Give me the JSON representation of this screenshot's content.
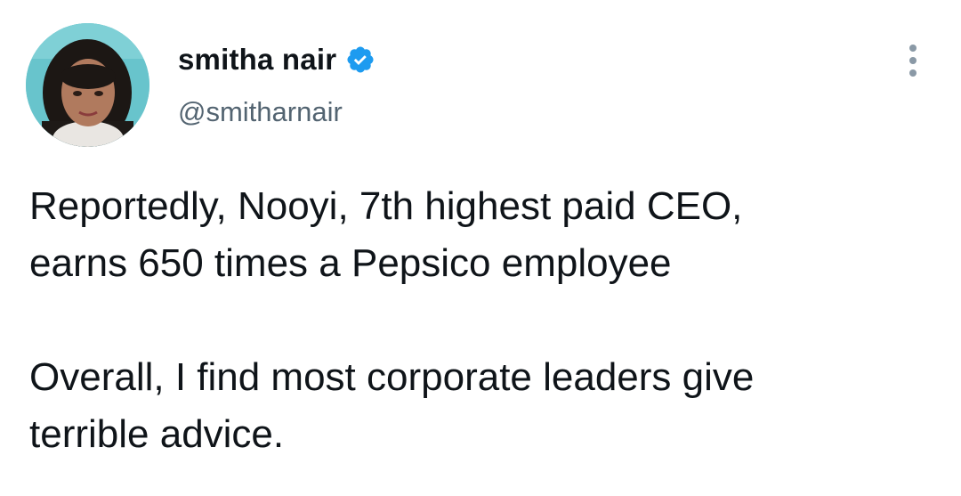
{
  "tweet": {
    "author": {
      "display_name": "smitha nair",
      "handle": "@smitharnair",
      "verified_icon": "verified-badge-icon",
      "avatar_icon": "profile-photo"
    },
    "more_icon": "more-options-icon",
    "body": {
      "line1": "Reportedly, Nooyi, 7th highest paid CEO,",
      "line2": "earns 650 times a Pepsico employee",
      "line3": "Overall, I find most corporate leaders give",
      "line4": "terrible advice."
    },
    "colors": {
      "text": "#0f1419",
      "secondary": "#536471",
      "verified": "#1d9bf0"
    }
  }
}
